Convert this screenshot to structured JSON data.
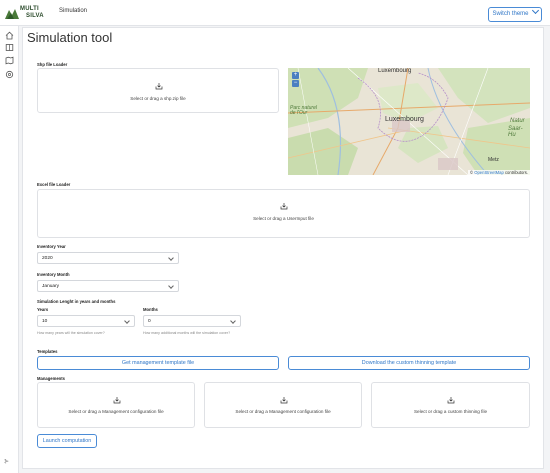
{
  "header": {
    "logo_line1": "MULTI",
    "logo_line2": "SILVA",
    "title": "Simulation",
    "theme_button": "Switch theme"
  },
  "sidebar": {
    "icons": [
      "home-icon",
      "book-icon",
      "map-icon",
      "settings-icon"
    ],
    "collapse": "⊱"
  },
  "page": {
    "title": "Simulation tool"
  },
  "shp_loader": {
    "label": "Shp file Loader",
    "prompt": "Select or drag a shp.zip file"
  },
  "map": {
    "labels": {
      "luxembourg_top": "Luxembourg",
      "luxembourg_center": "Luxembourg",
      "park": "Parc naturel\nde l'Our",
      "natur": "Natur",
      "saar": "Saar-Hu",
      "metz": "Metz"
    },
    "attribution_symbol": "©",
    "attribution_link": "OpenStreetMap",
    "attribution_text": "contributors."
  },
  "excel_loader": {
    "label": "Excel file Loader",
    "prompt": "Select or drag a UserInput file"
  },
  "inventory_year": {
    "label": "Inventory Year",
    "value": "2020"
  },
  "inventory_month": {
    "label": "Inventory Month",
    "value": "January"
  },
  "simulation_length": {
    "label": "Simulation Lenght in years and months",
    "years_label": "Years",
    "years_value": "10",
    "years_help": "How many years will the simulation cover?",
    "months_label": "Months",
    "months_value": "0",
    "months_help": "How many additional months will the simulation cover?"
  },
  "templates": {
    "label": "Templates",
    "management_button": "Get management template file",
    "thinning_button": "Download the custom thinning template"
  },
  "managements": {
    "label": "Managements",
    "zones": [
      "Select or drag a Management configuration file",
      "Select or drag a Management configuration file",
      "Select or drag a custom thinning file"
    ]
  },
  "launch_button": "Launch computation"
}
